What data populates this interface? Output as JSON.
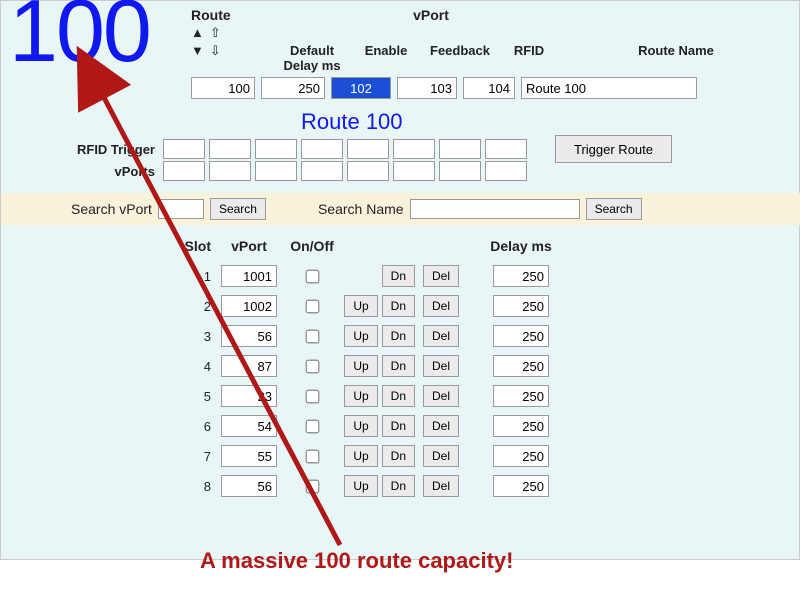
{
  "overlay": {
    "big_number": "100",
    "caption": "A massive 100 route capacity!"
  },
  "top": {
    "route_label": "Route",
    "vport_label": "vPort",
    "default_delay_label": "Default Delay ms",
    "enable_label": "Enable",
    "feedback_label": "Feedback",
    "rfid_label": "RFID",
    "route_name_label": "Route Name",
    "route_value": "100",
    "default_delay_value": "250",
    "enable_value": "102",
    "feedback_value": "103",
    "rfid_value": "104",
    "route_name_value": "Route 100",
    "arrows": {
      "up_filled": "▲",
      "up_outline": "⇧",
      "down_filled": "▼",
      "down_outline": "⇩"
    }
  },
  "route_title": "Route 100",
  "trigger": {
    "rfid_trigger_label": "RFID Trigger",
    "vports_label": "vPorts",
    "trigger_button": "Trigger Route"
  },
  "search": {
    "search_vport_label": "Search vPort",
    "search_name_label": "Search Name",
    "search_button": "Search"
  },
  "table": {
    "headers": {
      "slot": "Slot",
      "vport": "vPort",
      "onoff": "On/Off",
      "delay": "Delay ms"
    },
    "btn_up": "Up",
    "btn_dn": "Dn",
    "btn_del": "Del",
    "rows": [
      {
        "slot": "1",
        "vport": "1001",
        "delay": "250",
        "show_up": false
      },
      {
        "slot": "2",
        "vport": "1002",
        "delay": "250",
        "show_up": true
      },
      {
        "slot": "3",
        "vport": "56",
        "delay": "250",
        "show_up": true
      },
      {
        "slot": "4",
        "vport": "87",
        "delay": "250",
        "show_up": true
      },
      {
        "slot": "5",
        "vport": "23",
        "delay": "250",
        "show_up": true
      },
      {
        "slot": "6",
        "vport": "54",
        "delay": "250",
        "show_up": true
      },
      {
        "slot": "7",
        "vport": "55",
        "delay": "250",
        "show_up": true
      },
      {
        "slot": "8",
        "vport": "56",
        "delay": "250",
        "show_up": true
      }
    ]
  }
}
